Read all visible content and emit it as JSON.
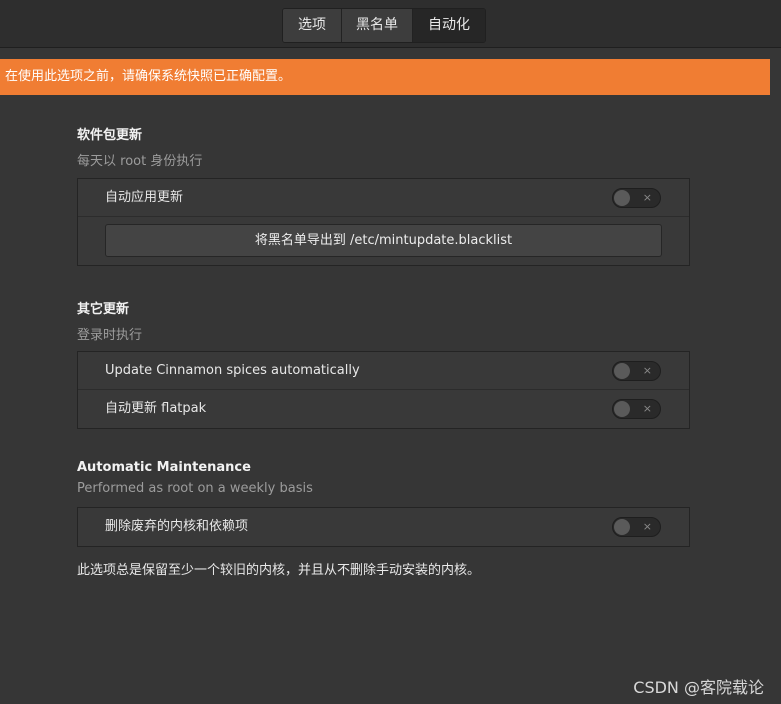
{
  "tabs": [
    {
      "label": "选项"
    },
    {
      "label": "黑名单"
    },
    {
      "label": "自动化"
    }
  ],
  "warning": "在使用此选项之前，请确保系统快照已正确配置。",
  "sections": {
    "packages": {
      "title": "软件包更新",
      "subtitle": "每天以 root 身份执行",
      "toggle_label": "自动应用更新",
      "export_button": "将黑名单导出到  /etc/mintupdate.blacklist"
    },
    "other": {
      "title": "其它更新",
      "subtitle": "登录时执行",
      "spices_label": "Update Cinnamon spices automatically",
      "flatpak_label": "自动更新 flatpak"
    },
    "maintenance": {
      "title": "Automatic Maintenance",
      "subtitle": "Performed as root on a weekly basis",
      "remove_label": "删除废弃的内核和依赖项",
      "note": "此选项总是保留至少一个较旧的内核，并且从不删除手动安装的内核。"
    }
  },
  "switch_glyph": "×",
  "switch_states": {
    "auto_apply": false,
    "spices": false,
    "flatpak": false,
    "remove_kernels": false
  },
  "watermark": "CSDN @客院载论",
  "colors": {
    "background": "#363636",
    "warning": "#f07d33",
    "active_tab": "#262626"
  }
}
